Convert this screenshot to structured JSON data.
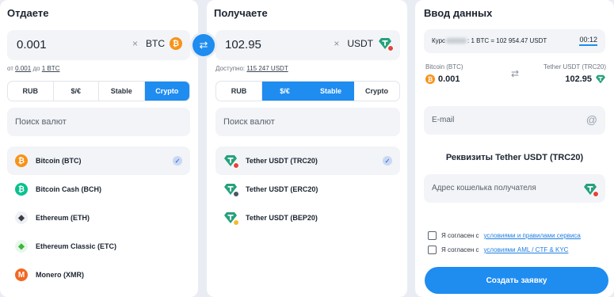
{
  "give": {
    "title": "Отдаете",
    "amount": "0.001",
    "currency": "BTC",
    "clear": "×",
    "hint_prefix": "от",
    "hint_min": "0.001",
    "hint_mid": "до",
    "hint_max": "1 BTC",
    "tabs": [
      "RUB",
      "$/€",
      "Stable",
      "Crypto"
    ],
    "active_tab": "Crypto",
    "search_placeholder": "Поиск валют",
    "coins": [
      {
        "name": "Bitcoin (BTC)",
        "icon": "bitcoin-icon",
        "selected": true
      },
      {
        "name": "Bitcoin Cash (BCH)",
        "icon": "bitcoin-cash-icon"
      },
      {
        "name": "Ethereum (ETH)",
        "icon": "ethereum-icon"
      },
      {
        "name": "Ethereum Classic (ETC)",
        "icon": "ethereum-classic-icon"
      },
      {
        "name": "Monero (XMR)",
        "icon": "monero-icon"
      }
    ]
  },
  "get": {
    "title": "Получаете",
    "amount": "102.95",
    "currency": "USDT",
    "clear": "×",
    "available_label": "Доступно:",
    "available_value": "115 247 USDT",
    "tabs": [
      "RUB",
      "$/€",
      "Stable",
      "Crypto"
    ],
    "active_tabs": [
      "$/€",
      "Stable"
    ],
    "search_placeholder": "Поиск валют",
    "coins": [
      {
        "name": "Tether USDT (TRC20)",
        "icon": "tether-trc20-icon",
        "selected": true
      },
      {
        "name": "Tether USDT (ERC20)",
        "icon": "tether-erc20-icon"
      },
      {
        "name": "Tether USDT (BEP20)",
        "icon": "tether-bep20-icon"
      }
    ]
  },
  "form": {
    "title": "Ввод данных",
    "rate_prefix": "Курс",
    "rate_text": ": 1 BTC = 102 954.47 USDT",
    "timer": "00:12",
    "from_label": "Bitcoin (BTC)",
    "from_value": "0.001",
    "to_label": "Tether USDT (TRC20)",
    "to_value": "102.95",
    "email_placeholder": "E-mail",
    "requisites_title": "Реквизиты Tether USDT (TRC20)",
    "wallet_placeholder": "Адрес кошелька получателя",
    "agree1_text": "Я согласен с",
    "agree1_link": "условиями и правилами сервиса",
    "agree2_text": "Я согласен с",
    "agree2_link": "условиями AML / CTF & KYC",
    "submit": "Создать заявку"
  },
  "colors": {
    "accent": "#1f8cf0",
    "btc": "#f7931a",
    "tether": "#26a17b",
    "trc20": "#e8423a"
  }
}
